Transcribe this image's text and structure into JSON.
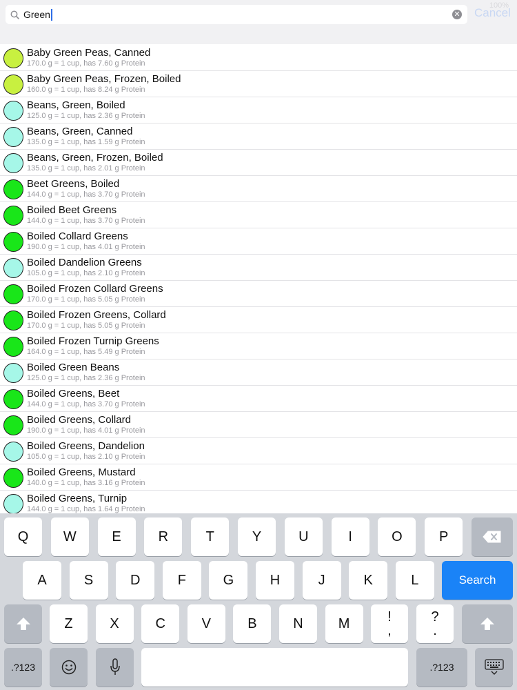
{
  "status": {
    "battery": "100%"
  },
  "search": {
    "value": "Green",
    "cancel_label": "Cancel"
  },
  "colors": {
    "yellow_green": "#c8f040",
    "light_cyan": "#a6f7e8",
    "bright_green": "#19e619",
    "search_key": "#1a83f7"
  },
  "items": [
    {
      "title": "Baby Green Peas, Canned",
      "sub": "170.0 g = 1 cup, has 7.60 g Protein",
      "color": "#c8f040"
    },
    {
      "title": "Baby Green Peas, Frozen, Boiled",
      "sub": "160.0 g = 1 cup, has 8.24 g Protein",
      "color": "#c8f040"
    },
    {
      "title": "Beans, Green, Boiled",
      "sub": "125.0 g = 1 cup, has 2.36 g Protein",
      "color": "#a6f7e8"
    },
    {
      "title": "Beans, Green, Canned",
      "sub": "135.0 g = 1 cup, has 1.59 g Protein",
      "color": "#a6f7e8"
    },
    {
      "title": "Beans, Green, Frozen, Boiled",
      "sub": "135.0 g = 1 cup, has 2.01 g Protein",
      "color": "#a6f7e8"
    },
    {
      "title": "Beet Greens, Boiled",
      "sub": "144.0 g = 1 cup, has 3.70 g Protein",
      "color": "#19e619"
    },
    {
      "title": "Boiled Beet Greens",
      "sub": "144.0 g = 1 cup, has 3.70 g Protein",
      "color": "#19e619"
    },
    {
      "title": "Boiled Collard Greens",
      "sub": "190.0 g = 1 cup, has 4.01 g Protein",
      "color": "#19e619"
    },
    {
      "title": "Boiled Dandelion Greens",
      "sub": "105.0 g = 1 cup, has 2.10 g Protein",
      "color": "#a6f7e8"
    },
    {
      "title": "Boiled Frozen Collard Greens",
      "sub": "170.0 g = 1 cup, has 5.05 g Protein",
      "color": "#19e619"
    },
    {
      "title": "Boiled Frozen Greens, Collard",
      "sub": "170.0 g = 1 cup, has 5.05 g Protein",
      "color": "#19e619"
    },
    {
      "title": "Boiled Frozen Turnip Greens",
      "sub": "164.0 g = 1 cup, has 5.49 g Protein",
      "color": "#19e619"
    },
    {
      "title": "Boiled Green Beans",
      "sub": "125.0 g = 1 cup, has 2.36 g Protein",
      "color": "#a6f7e8"
    },
    {
      "title": "Boiled Greens, Beet",
      "sub": "144.0 g = 1 cup, has 3.70 g Protein",
      "color": "#19e619"
    },
    {
      "title": "Boiled Greens, Collard",
      "sub": "190.0 g = 1 cup, has 4.01 g Protein",
      "color": "#19e619"
    },
    {
      "title": "Boiled Greens, Dandelion",
      "sub": "105.0 g = 1 cup, has 2.10 g Protein",
      "color": "#a6f7e8"
    },
    {
      "title": "Boiled Greens, Mustard",
      "sub": "140.0 g = 1 cup, has 3.16 g Protein",
      "color": "#19e619"
    },
    {
      "title": "Boiled Greens, Turnip",
      "sub": "144.0 g = 1 cup, has 1.64 g Protein",
      "color": "#a6f7e8"
    }
  ],
  "keyboard": {
    "row1": [
      "Q",
      "W",
      "E",
      "R",
      "T",
      "Y",
      "U",
      "I",
      "O",
      "P"
    ],
    "row2": [
      "A",
      "S",
      "D",
      "F",
      "G",
      "H",
      "J",
      "K",
      "L"
    ],
    "row3": [
      "Z",
      "X",
      "C",
      "V",
      "B",
      "N",
      "M"
    ],
    "search_label": "Search",
    "numbers_label": ".?123",
    "punct1_top": "!",
    "punct1_bottom": ",",
    "punct2_top": "?",
    "punct2_bottom": "."
  }
}
